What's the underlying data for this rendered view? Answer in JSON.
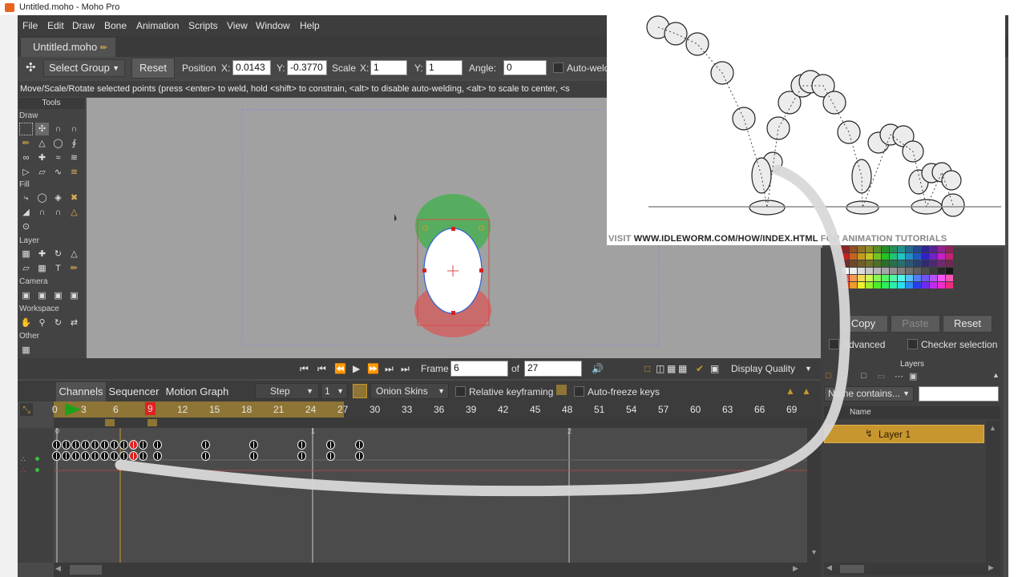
{
  "window_title": "Untitled.moho - Moho Pro",
  "menu": [
    "File",
    "Edit",
    "Draw",
    "Bone",
    "Animation",
    "Scripts",
    "View",
    "Window",
    "Help"
  ],
  "doc_tab": "Untitled.moho",
  "doc_tab_icon": "pencil-icon",
  "options": {
    "group_label": "Select Group",
    "reset": "Reset",
    "position_label": "Position",
    "x_label": "X:",
    "x_value": "0.0143",
    "y_label": "Y:",
    "y_value": "-0.3770",
    "scale_label": "Scale",
    "scale_x_label": "X:",
    "scale_x": "1",
    "scale_y_label": "Y:",
    "scale_y": "1",
    "angle_label": "Angle:",
    "angle": "0",
    "autoweld": "Auto-weld"
  },
  "status": "Move/Scale/Rotate selected points (press <enter> to weld, hold <shift> to constrain, <alt> to disable auto-welding, <alt> to scale to center, <s",
  "tools": {
    "header": "Tools",
    "sections": [
      "Draw",
      "Fill",
      "Layer",
      "Camera",
      "Workspace",
      "Other"
    ]
  },
  "navbar": {
    "frame_label": "Frame",
    "frame": "6",
    "of_label": "of",
    "total": "27",
    "display_quality": "Display Quality"
  },
  "timeline": {
    "tabs": [
      "Channels",
      "Sequencer",
      "Motion Graph"
    ],
    "step": "Step",
    "step_value": "1",
    "onion_skins": "Onion Skins",
    "relative_keyframing": "Relative keyframing",
    "auto_freeze": "Auto-freeze keys",
    "ruler": [
      "0",
      "3",
      "6",
      "9",
      "12",
      "15",
      "18",
      "21",
      "24",
      "27",
      "30",
      "33",
      "36",
      "39",
      "42",
      "45",
      "48",
      "51",
      "54",
      "57",
      "60",
      "63",
      "66",
      "69"
    ],
    "current_frame": "9",
    "seconds": [
      "0",
      "1",
      "2"
    ]
  },
  "styles_panel": {
    "copy": "Copy",
    "paste": "Paste",
    "reset": "Reset",
    "advanced": "Advanced",
    "checker": "Checker selection"
  },
  "layers_panel": {
    "title": "Layers",
    "filter": "Name contains...",
    "column_name": "Name",
    "layer": "Layer 1"
  },
  "overlay": {
    "caption_prefix": "VISIT",
    "caption_url": "WWW.IDLEWORM.COM/HOW/INDEX.HTML",
    "caption_suffix": "FOR ANIMATION TUTORIALS"
  },
  "colors": {
    "accent": "#c8962e",
    "keyframe_selected": "#e02020",
    "playhead": "#c8962e"
  }
}
